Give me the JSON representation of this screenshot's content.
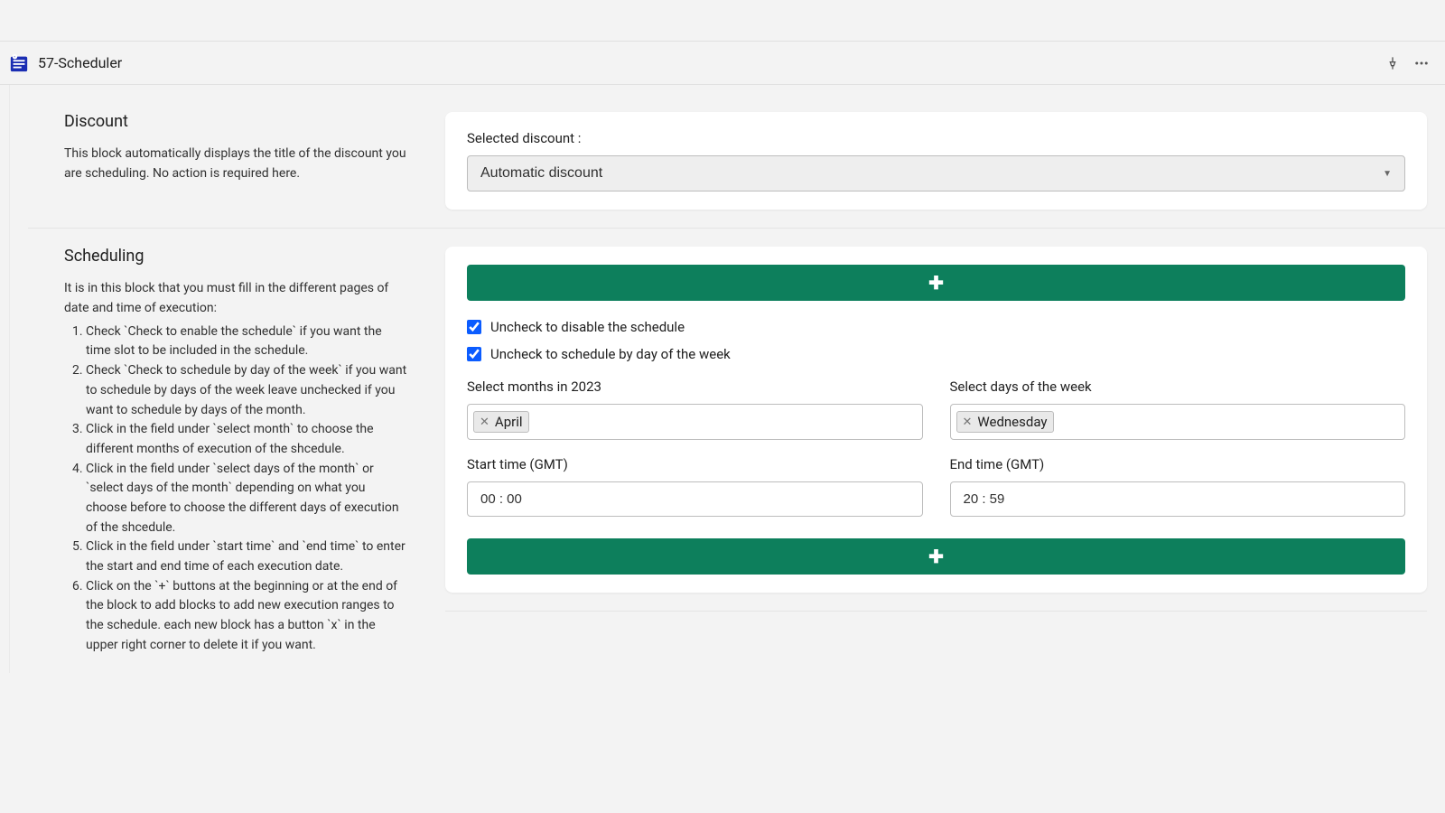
{
  "header": {
    "title": "57-Scheduler"
  },
  "discount_section": {
    "title": "Discount",
    "description": "This block automatically displays the title of the discount you are scheduling. No action is required here.",
    "select_label": "Selected discount :",
    "select_value": "Automatic discount"
  },
  "scheduling_section": {
    "title": "Scheduling",
    "intro": "It is in this block that you must fill in the different pages of date and time of execution:",
    "steps": [
      "Check `Check to enable the schedule` if you want the time slot to be included in the schedule.",
      "Check `Check to schedule by day of the week` if you want to schedule by days of the week leave unchecked if you want to schedule by days of the month.",
      "Click in the field under `select month` to choose the different months of execution of the shcedule.",
      "Click in the field under `select days of the month` or `select days of the month` depending on what you choose before to choose the different days of execution of the shcedule.",
      "Click in the field under `start time` and `end time` to enter the start and end time of each execution date.",
      "Click on the `+` buttons at the beginning or at the end of the block to add blocks to add new execution ranges to the schedule. each new block has a button `x` in the upper right corner to delete it if you want."
    ],
    "checkbox1_label": "Uncheck to disable the schedule",
    "checkbox2_label": "Uncheck to schedule by day of the week",
    "months_label": "Select months in 2023",
    "months_tags": [
      "April"
    ],
    "days_label": "Select days of the week",
    "days_tags": [
      "Wednesday"
    ],
    "start_label": "Start time (GMT)",
    "start_value": "00 : 00",
    "end_label": "End time (GMT)",
    "end_value": "20 : 59",
    "plus": "✚"
  }
}
